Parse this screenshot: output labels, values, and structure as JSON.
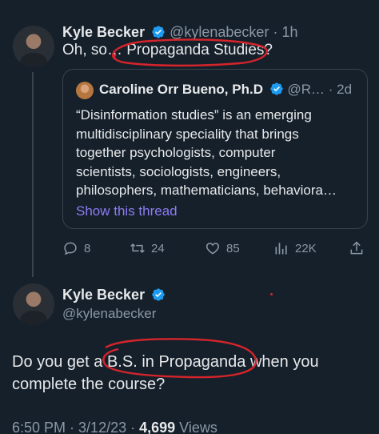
{
  "quoted_by": {
    "name": "Kyle Becker",
    "handle": "@kylenabecker",
    "time": "1h",
    "text": "Oh, so… Propaganda Studies?"
  },
  "quote": {
    "name": "Caroline Orr Bueno, Ph.D",
    "handle": "@R…",
    "time": "2d",
    "lines": [
      "“Disinformation studies” is an emerging",
      "multidisciplinary speciality that brings",
      "together psychologists, computer",
      "scientists, sociologists, engineers,",
      "philosophers, mathematicians, behaviora…"
    ],
    "show_thread": "Show this thread"
  },
  "actions": {
    "replies": "8",
    "retweets": "24",
    "likes": "85",
    "views": "22K"
  },
  "main": {
    "name": "Kyle Becker",
    "handle": "@kylenabecker",
    "lines": [
      "Do you get a B.S. in Propaganda when you",
      "complete the course?"
    ],
    "time": "6:50 PM",
    "date": "3/12/23",
    "views_count": "4,699",
    "views_label": "Views"
  },
  "colors": {
    "background": "#15202b",
    "verified": "#1d9bf0",
    "link": "#8e7cf4",
    "annotation": "#d6242b"
  }
}
